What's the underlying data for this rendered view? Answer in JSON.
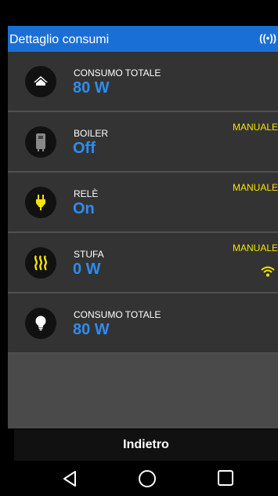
{
  "header": {
    "title": "Dettaglio consumi",
    "signal_icon": "((•))"
  },
  "items": [
    {
      "icon": "home-icon",
      "label": "CONSUMO TOTALE",
      "value": "80 W"
    },
    {
      "icon": "boiler-icon",
      "label": "BOILER",
      "value": "Off",
      "mode": "MANUALE"
    },
    {
      "icon": "plug-icon",
      "label": "RELÈ",
      "value": "On",
      "mode": "MANUALE"
    },
    {
      "icon": "heater-icon",
      "label": "STUFA",
      "value": "0 W",
      "mode": "MANUALE"
    },
    {
      "icon": "lightbulb-icon",
      "label": "CONSUMO TOTALE",
      "value": "80 W"
    }
  ],
  "footer": {
    "back_label": "Indietro"
  },
  "colors": {
    "accent": "#1a6fd6",
    "value_blue": "#2f8cf0",
    "mode_yellow": "#f6e600"
  }
}
